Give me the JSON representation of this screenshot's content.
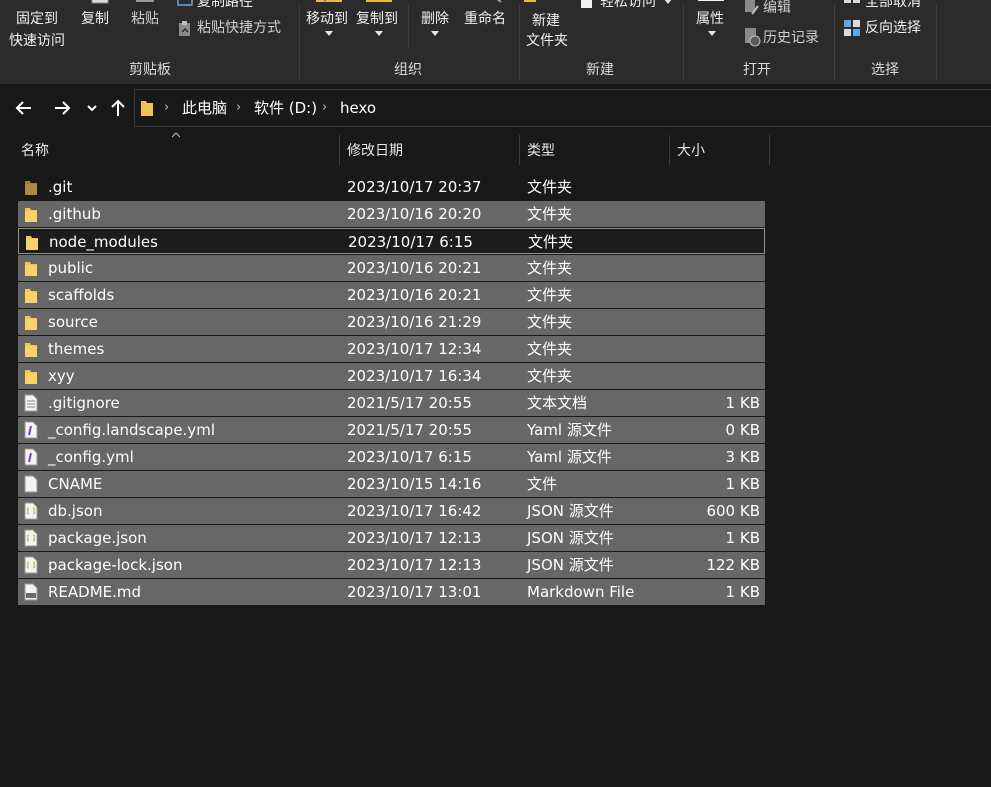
{
  "ribbon": {
    "groups": {
      "clipboard": {
        "label": "剪贴板",
        "pin_line1": "固定到",
        "pin_line2": "快速访问",
        "copy": "复制",
        "paste": "粘贴",
        "copy_path": "复制路径",
        "paste_shortcut": "粘贴快捷方式"
      },
      "organize": {
        "label": "组织",
        "move_to": "移动到",
        "copy_to": "复制到",
        "delete": "删除",
        "rename": "重命名"
      },
      "new": {
        "label": "新建",
        "new_folder_line1": "新建",
        "new_folder_line2": "文件夹",
        "easy_access": "轻松访问"
      },
      "open": {
        "label": "打开",
        "properties": "属性",
        "edit": "编辑",
        "history": "历史记录"
      },
      "select": {
        "label": "选择",
        "select_none": "全部取消",
        "invert": "反向选择"
      }
    }
  },
  "address": {
    "crumbs": [
      "此电脑",
      "软件 (D:)",
      "hexo"
    ]
  },
  "columns": {
    "name": "名称",
    "date": "修改日期",
    "type": "类型",
    "size": "大小"
  },
  "files": [
    {
      "name": ".git",
      "date": "2023/10/17 20:37",
      "type": "文件夹",
      "size": "",
      "icon": "folder-dim-icon",
      "state": "plain"
    },
    {
      "name": ".github",
      "date": "2023/10/16 20:20",
      "type": "文件夹",
      "size": "",
      "icon": "folder-icon",
      "state": "sel"
    },
    {
      "name": "node_modules",
      "date": "2023/10/17 6:15",
      "type": "文件夹",
      "size": "",
      "icon": "folder-icon",
      "state": "focus"
    },
    {
      "name": "public",
      "date": "2023/10/16 20:21",
      "type": "文件夹",
      "size": "",
      "icon": "folder-icon",
      "state": "sel"
    },
    {
      "name": "scaffolds",
      "date": "2023/10/16 20:21",
      "type": "文件夹",
      "size": "",
      "icon": "folder-icon",
      "state": "sel"
    },
    {
      "name": "source",
      "date": "2023/10/16 21:29",
      "type": "文件夹",
      "size": "",
      "icon": "folder-icon",
      "state": "sel"
    },
    {
      "name": "themes",
      "date": "2023/10/17 12:34",
      "type": "文件夹",
      "size": "",
      "icon": "folder-icon",
      "state": "sel"
    },
    {
      "name": "xyy",
      "date": "2023/10/17 16:34",
      "type": "文件夹",
      "size": "",
      "icon": "folder-icon",
      "state": "sel"
    },
    {
      "name": ".gitignore",
      "date": "2021/5/17 20:55",
      "type": "文本文档",
      "size": "1 KB",
      "icon": "text-file-icon",
      "state": "sel"
    },
    {
      "name": "_config.landscape.yml",
      "date": "2021/5/17 20:55",
      "type": "Yaml 源文件",
      "size": "0 KB",
      "icon": "yaml-file-icon",
      "state": "sel"
    },
    {
      "name": "_config.yml",
      "date": "2023/10/17 6:15",
      "type": "Yaml 源文件",
      "size": "3 KB",
      "icon": "yaml-file-icon",
      "state": "sel"
    },
    {
      "name": "CNAME",
      "date": "2023/10/15 14:16",
      "type": "文件",
      "size": "1 KB",
      "icon": "blank-file-icon",
      "state": "sel"
    },
    {
      "name": "db.json",
      "date": "2023/10/17 16:42",
      "type": "JSON 源文件",
      "size": "600 KB",
      "icon": "json-file-icon",
      "state": "sel"
    },
    {
      "name": "package.json",
      "date": "2023/10/17 12:13",
      "type": "JSON 源文件",
      "size": "1 KB",
      "icon": "json-file-icon",
      "state": "sel"
    },
    {
      "name": "package-lock.json",
      "date": "2023/10/17 12:13",
      "type": "JSON 源文件",
      "size": "122 KB",
      "icon": "json-file-icon",
      "state": "sel"
    },
    {
      "name": "README.md",
      "date": "2023/10/17 13:01",
      "type": "Markdown File",
      "size": "1 KB",
      "icon": "markdown-file-icon",
      "state": "sel"
    }
  ]
}
